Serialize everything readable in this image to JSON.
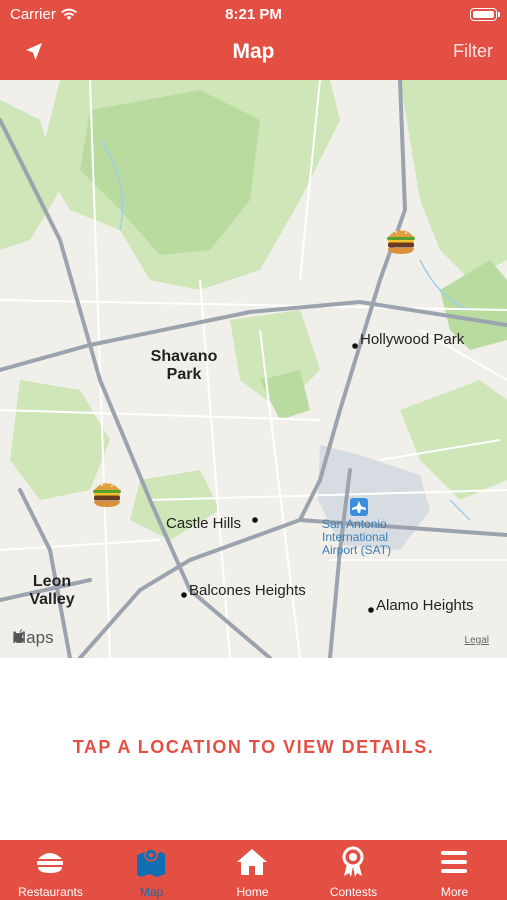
{
  "status_bar": {
    "carrier": "Carrier",
    "time": "8:21 PM"
  },
  "nav": {
    "title": "Map",
    "filter_label": "Filter",
    "locate_icon": "location-arrow-icon"
  },
  "map": {
    "labels": {
      "hollywood_park": "Hollywood Park",
      "shavano_park_1": "Shavano",
      "shavano_park_2": "Park",
      "castle_hills": "Castle Hills",
      "leon_valley_1": "Leon",
      "leon_valley_2": "Valley",
      "balcones_heights": "Balcones Heights",
      "alamo_heights": "Alamo Heights",
      "airport_1": "San Antonio",
      "airport_2": "International",
      "airport_3": "Airport (SAT)"
    },
    "pins": [
      "burger-pin",
      "burger-pin"
    ],
    "attribution": "Maps",
    "legal": "Legal"
  },
  "prompt": "TAP A LOCATION TO VIEW DETAILS.",
  "tabs": [
    {
      "label": "Restaurants",
      "icon": "burger-icon",
      "active": false
    },
    {
      "label": "Map",
      "icon": "map-icon",
      "active": true
    },
    {
      "label": "Home",
      "icon": "home-icon",
      "active": false
    },
    {
      "label": "Contests",
      "icon": "ribbon-award-icon",
      "active": false
    },
    {
      "label": "More",
      "icon": "menu-icon",
      "active": false
    }
  ],
  "colors": {
    "brand": "#e44f43",
    "active_tab": "#0f6fb0",
    "text_light": "#ffffff"
  }
}
